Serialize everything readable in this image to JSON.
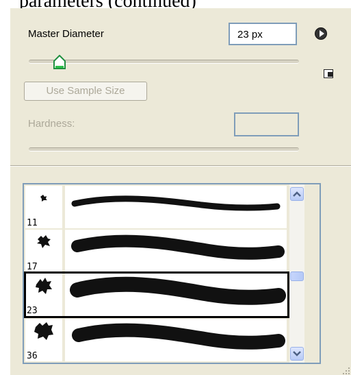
{
  "header_fragment": "parameters (continued)",
  "panel": {
    "master_diameter_label": "Master Diameter",
    "master_diameter_value": "23 px",
    "master_diameter_slider_fraction": 0.14,
    "use_sample_size_label": "Use Sample Size",
    "hardness_label": "Hardness:",
    "hardness_value": "",
    "icons": {
      "menu": "flyout-menu-arrow-icon",
      "new_preset": "new-preset-icon",
      "resize_grip": "resize-grip-icon"
    }
  },
  "brush_list": {
    "items": [
      {
        "size": "11",
        "selected": false
      },
      {
        "size": "17",
        "selected": false
      },
      {
        "size": "23",
        "selected": true
      },
      {
        "size": "36",
        "selected": false
      }
    ]
  },
  "colors": {
    "panel_bg": "#ECE9D8",
    "field_border": "#7F9DB9",
    "disabled_text": "#ACA899",
    "scroll_accent": "#B7CAF6"
  }
}
